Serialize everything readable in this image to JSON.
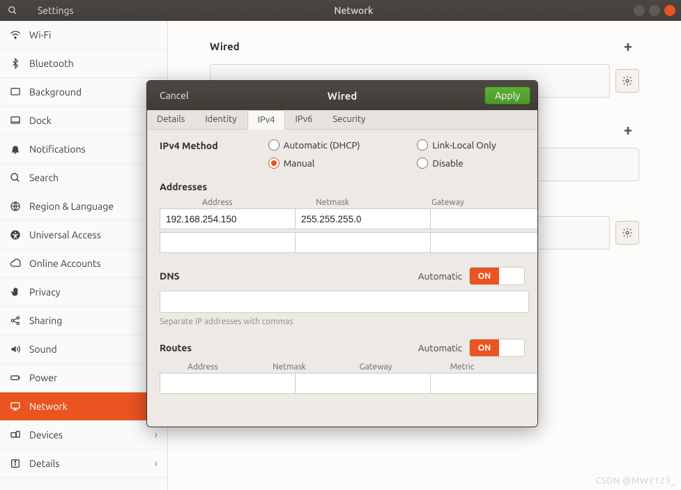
{
  "titlebar": {
    "left": "Settings",
    "center": "Network"
  },
  "sidebar": {
    "items": [
      {
        "label": "Wi-Fi"
      },
      {
        "label": "Bluetooth"
      },
      {
        "label": "Background"
      },
      {
        "label": "Dock"
      },
      {
        "label": "Notifications"
      },
      {
        "label": "Search"
      },
      {
        "label": "Region & Language"
      },
      {
        "label": "Universal Access"
      },
      {
        "label": "Online Accounts"
      },
      {
        "label": "Privacy"
      },
      {
        "label": "Sharing"
      },
      {
        "label": "Sound"
      },
      {
        "label": "Power"
      },
      {
        "label": "Network"
      },
      {
        "label": "Devices"
      },
      {
        "label": "Details"
      }
    ],
    "active_index": 13,
    "chevron_indices": [
      14,
      15
    ]
  },
  "main": {
    "wired_label": "Wired"
  },
  "modal": {
    "cancel": "Cancel",
    "title": "Wired",
    "apply": "Apply",
    "tabs": [
      "Details",
      "Identity",
      "IPv4",
      "IPv6",
      "Security"
    ],
    "active_tab": 2,
    "ipv4": {
      "method_label": "IPv4 Method",
      "opts": {
        "auto": "Automatic (DHCP)",
        "linklocal": "Link-Local Only",
        "manual": "Manual",
        "disable": "Disable"
      },
      "selected": "manual",
      "addresses_label": "Addresses",
      "addr_cols": {
        "c1": "Address",
        "c2": "Netmask",
        "c3": "Gateway"
      },
      "rows": [
        {
          "address": "192.168.254.150",
          "netmask": "255.255.255.0",
          "gateway": ""
        },
        {
          "address": "",
          "netmask": "",
          "gateway": ""
        }
      ],
      "dns_label": "DNS",
      "automatic_label": "Automatic",
      "toggle_on": "ON",
      "dns_hint": "Separate IP addresses with commas",
      "routes_label": "Routes",
      "routes_cols": {
        "c1": "Address",
        "c2": "Netmask",
        "c3": "Gateway",
        "c4": "Metric"
      }
    }
  },
  "watermark": "CSDN @MWY123_"
}
